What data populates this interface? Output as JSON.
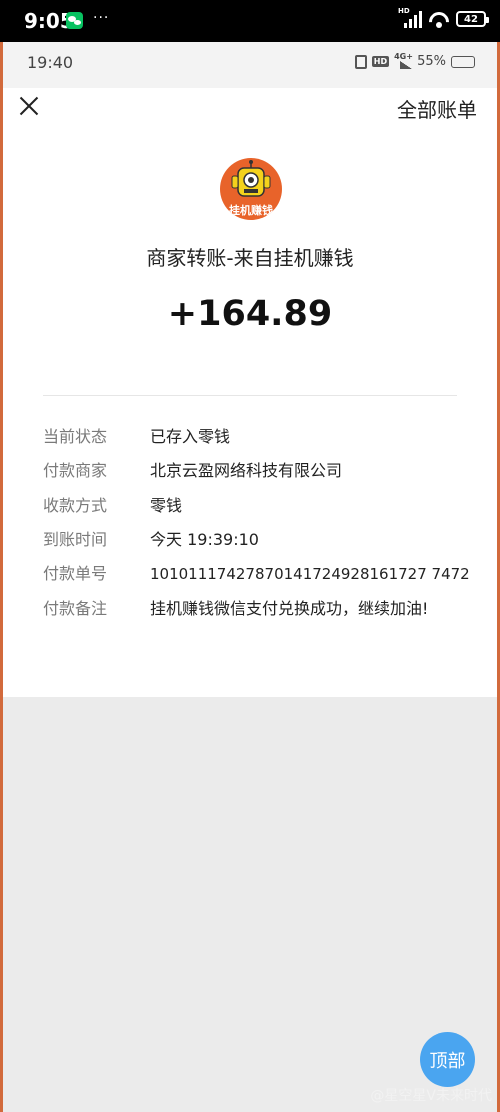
{
  "outer_status": {
    "time": "9:05",
    "indicators": "···",
    "battery": "42",
    "icons": [
      "wechat-icon",
      "signal-icon",
      "wifi-icon",
      "battery-icon"
    ]
  },
  "inner_status": {
    "time": "19:40",
    "battery_percent": "55%",
    "network": "4G+",
    "hd": "HD",
    "battery_fill": 0.55
  },
  "header": {
    "close_icon": "close-icon",
    "all_bills": "全部账单"
  },
  "transaction": {
    "avatar_text": "挂机赚钱",
    "title": "商家转账-来自挂机赚钱",
    "amount": "+164.89"
  },
  "details": [
    {
      "label": "当前状态",
      "value": "已存入零钱"
    },
    {
      "label": "付款商家",
      "value": "北京云盈网络科技有限公司"
    },
    {
      "label": "收款方式",
      "value": "零钱"
    },
    {
      "label": "到账时间",
      "value": "今天 19:39:10"
    },
    {
      "label": "付款单号",
      "value": "10101117427870141724928161727 7472"
    },
    {
      "label": "付款备注",
      "value": "挂机赚钱微信支付兑换成功，继续加油!"
    }
  ],
  "top_button": "顶部",
  "watermark": "@星空星V未来时代",
  "colors": {
    "brand_orange": "#e8632a",
    "top_button_blue": "#4aa5f0"
  }
}
